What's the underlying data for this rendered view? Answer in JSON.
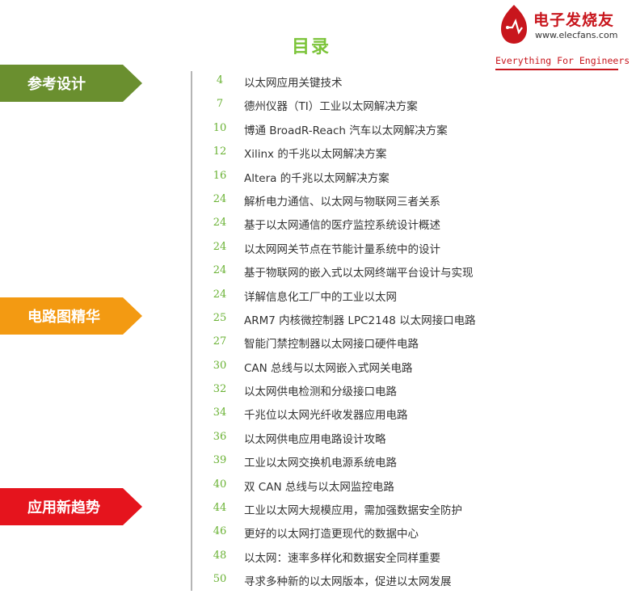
{
  "title": "目录",
  "logo": {
    "name": "电子发烧友",
    "url": "www.elecfans.com",
    "tagline": "Everything For Engineers",
    "color": "#c8161d"
  },
  "sections": [
    {
      "label": "参考设计",
      "color": "#6a8f2f"
    },
    {
      "label": "电路图精华",
      "color": "#f39a12"
    },
    {
      "label": "应用新趋势",
      "color": "#e5141d"
    }
  ],
  "toc": [
    {
      "page": "4",
      "title": "以太网应用关键技术"
    },
    {
      "page": "7",
      "title": "德州仪器（TI）工业以太网解决方案"
    },
    {
      "page": "10",
      "title": "博通 BroadR-Reach 汽车以太网解决方案"
    },
    {
      "page": "12",
      "title": "Xilinx 的千兆以太网解决方案"
    },
    {
      "page": "16",
      "title": "Altera 的千兆以太网解决方案"
    },
    {
      "page": "24",
      "title": "解析电力通信、以太网与物联网三者关系"
    },
    {
      "page": "24",
      "title": "基于以太网通信的医疗监控系统设计概述"
    },
    {
      "page": "24",
      "title": "以太网网关节点在节能计量系统中的设计"
    },
    {
      "page": "24",
      "title": "基于物联网的嵌入式以太网终端平台设计与实现"
    },
    {
      "page": "24",
      "title": "详解信息化工厂中的工业以太网"
    },
    {
      "page": "25",
      "title": "ARM7 内核微控制器 LPC2148 以太网接口电路"
    },
    {
      "page": "27",
      "title": "智能门禁控制器以太网接口硬件电路"
    },
    {
      "page": "30",
      "title": "CAN 总线与以太网嵌入式网关电路"
    },
    {
      "page": "32",
      "title": "以太网供电检测和分级接口电路"
    },
    {
      "page": "34",
      "title": "千兆位以太网光纤收发器应用电路"
    },
    {
      "page": "36",
      "title": "以太网供电应用电路设计攻略"
    },
    {
      "page": "39",
      "title": "工业以太网交换机电源系统电路"
    },
    {
      "page": "40",
      "title": "双 CAN 总线与以太网监控电路"
    },
    {
      "page": "44",
      "title": "工业以太网大规模应用，需加强数据安全防护"
    },
    {
      "page": "46",
      "title": "更好的以太网打造更现代的数据中心"
    },
    {
      "page": "48",
      "title": "以太网：速率多样化和数据安全同样重要"
    },
    {
      "page": "50",
      "title": "寻求多种新的以太网版本，促进以太网发展"
    }
  ]
}
